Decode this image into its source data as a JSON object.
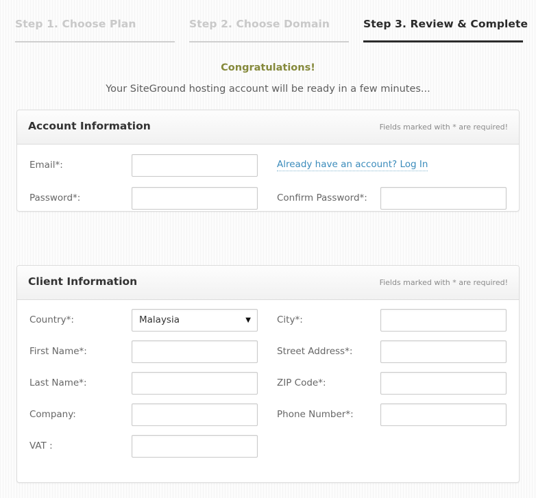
{
  "steps": [
    {
      "label": "Step 1. Choose Plan",
      "state": "inactive"
    },
    {
      "label": "Step 2. Choose Domain",
      "state": "inactive"
    },
    {
      "label": "Step 3. Review & Complete",
      "state": "active"
    }
  ],
  "message": {
    "title": "Congratulations!",
    "subtitle": "Your SiteGround hosting account will be ready in a few minutes...",
    "title_color": "#85893b"
  },
  "account_panel": {
    "title": "Account Information",
    "note": "Fields marked with * are required!",
    "fields": {
      "email_label": "Email*:",
      "email_value": "",
      "password_label": "Password*:",
      "password_value": "",
      "confirm_password_label": "Confirm Password*:",
      "confirm_password_value": ""
    },
    "login_link": "Already have an account? Log In",
    "link_color": "#3a8bbb"
  },
  "client_panel": {
    "title": "Client Information",
    "note": "Fields marked with * are required!",
    "fields": {
      "country_label": "Country*:",
      "country_value": "Malaysia",
      "country_arrow": "chevron-down-icon",
      "first_name_label": "First Name*:",
      "first_name_value": "",
      "last_name_label": "Last Name*:",
      "last_name_value": "",
      "company_label": "Company:",
      "company_value": "",
      "vat_label": "VAT :",
      "vat_value": "",
      "city_label": "City*:",
      "city_value": "",
      "street_label": "Street Address*:",
      "street_value": "",
      "zip_label": "ZIP Code*:",
      "zip_value": "",
      "phone_label": "Phone Number*:",
      "phone_value": ""
    }
  }
}
